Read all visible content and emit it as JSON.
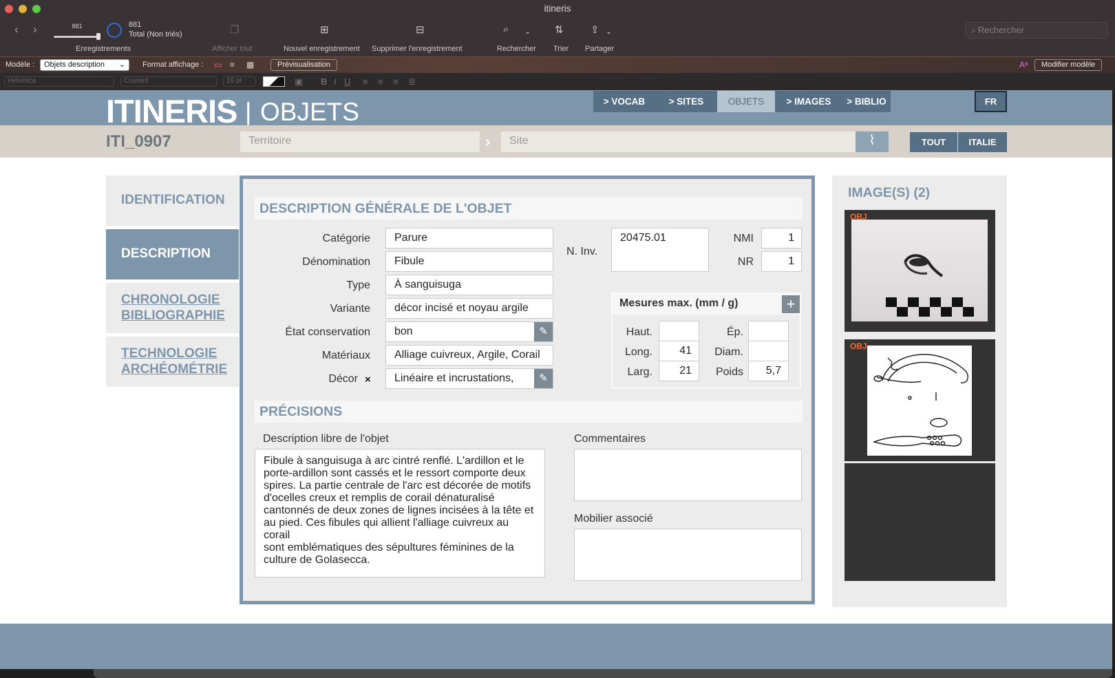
{
  "window": {
    "title": "itineris"
  },
  "toolbar": {
    "record_current": "881",
    "record_total": "881",
    "total_label": "Total (Non triés)",
    "records_label": "Enregistrements",
    "show_all": "Afficher tout",
    "new_record": "Nouvel enregistrement",
    "delete_record": "Supprimer l'enregistrement",
    "find": "Rechercher",
    "sort": "Trier",
    "share": "Partager",
    "search_placeholder": "Rechercher"
  },
  "layoutbar": {
    "model_label": "Modèle :",
    "model_value": "Objets description",
    "format_label": "Format affichage :",
    "preview": "Prévisualisation",
    "edit_model": "Modifier modèle"
  },
  "formatbar": {
    "font": "Helvetica",
    "style": "Courant",
    "size": "16 pt"
  },
  "header": {
    "brand": "ITINERIS",
    "separator": "|",
    "section": "OBJETS",
    "nav": [
      "> VOCAB",
      "> SITES",
      "OBJETS",
      "> IMAGES",
      "> BIBLIO"
    ],
    "lang": "FR"
  },
  "subheader": {
    "record_id": "ITI_0907",
    "territoire_placeholder": "Territoire",
    "site_placeholder": "Site",
    "btn_all": "TOUT",
    "btn_italie": "ITALIE"
  },
  "tabs": {
    "identification": "IDENTIFICATION",
    "description": "DESCRIPTION",
    "chronologie": "CHRONOLOGIE",
    "bibliographie": "BIBLIOGRAPHIE",
    "technologie": "TECHNOLOGIE",
    "archeometrie": "ARCHÉOMÉTRIE"
  },
  "description": {
    "title": "DESCRIPTION GÉNÉRALE DE L'OBJET",
    "fields": [
      {
        "label": "Catégorie",
        "value": "Parure"
      },
      {
        "label": "Dénomination",
        "value": "Fibule"
      },
      {
        "label": "Type",
        "value": "À sanguisuga"
      },
      {
        "label": "Variante",
        "value": "décor incisé et noyau argile"
      },
      {
        "label": "État conservation",
        "value": "bon"
      },
      {
        "label": "Matériaux",
        "value": "Alliage cuivreux, Argile, Corail"
      },
      {
        "label": "Décor",
        "value": "Linéaire et incrustations,"
      }
    ],
    "ninv_label": "N. Inv.",
    "ninv_value": "20475.01",
    "nmi_label": "NMI",
    "nmi_value": "1",
    "nr_label": "NR",
    "nr_value": "1"
  },
  "measures": {
    "title": "Mesures max. (mm / g)",
    "haut_label": "Haut.",
    "haut_value": "",
    "long_label": "Long.",
    "long_value": "41",
    "larg_label": "Larg.",
    "larg_value": "21",
    "ep_label": "Ép.",
    "ep_value": "",
    "diam_label": "Diam.",
    "diam_value": "",
    "poids_label": "Poids",
    "poids_value": "5,7"
  },
  "precisions": {
    "title": "PRÉCISIONS",
    "desc_label": "Description libre de l'objet",
    "desc_lines": [
      "Fibule à sanguisuga à arc cintré renflé. L'ardillon et le",
      "porte-ardillon sont cassés et le ressort comporte deux",
      "spires. La partie centrale de l'arc est décorée de motifs",
      "d'ocelles creux et remplis de corail dénaturalisé",
      "cantonnés de deux zones de lignes incisées à la tête et",
      "au pied. Ces fibules qui allient l'alliage cuivreux au corail",
      "sont emblématiques des sépultures féminines de la",
      "culture de Golasecca."
    ],
    "comments_label": "Commentaires",
    "comments_value": "",
    "mobilier_label": "Mobilier associé",
    "mobilier_value": ""
  },
  "images": {
    "title": "IMAGE(S) (2)",
    "tags": [
      "OBJ",
      "OBJ"
    ]
  }
}
